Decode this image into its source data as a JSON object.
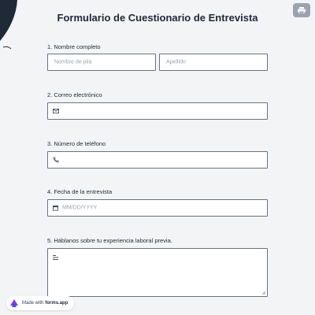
{
  "form": {
    "title": "Formulario de Cuestionario de Entrevista"
  },
  "questions": [
    {
      "label": "1.  Nombre completo",
      "first_placeholder": "Nombre de pila",
      "last_placeholder": "Apellido"
    },
    {
      "label": "2. Correo electrónico",
      "icon": "envelope-icon"
    },
    {
      "label": "3. Número de teléfono",
      "icon": "phone-icon"
    },
    {
      "label": "4. Fecha de la entrevista",
      "icon": "calendar-icon",
      "placeholder": "MM/DD/YYYY"
    },
    {
      "label": "5. Háblanos sobre tu experiencia laboral previa.",
      "icon": "text-lines-icon"
    }
  ],
  "footer": {
    "made_with": "Made with",
    "brand": "forms.app"
  },
  "colors": {
    "background": "#f3f4f6",
    "border": "#6b7280",
    "placeholder": "#9ca3af"
  }
}
